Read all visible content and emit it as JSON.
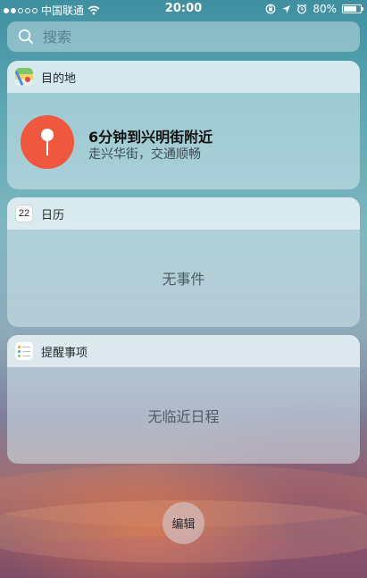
{
  "status_bar": {
    "carrier": "中国联通",
    "time": "20:00",
    "battery": "80%",
    "battery_level": 0.8,
    "signal_bars_filled": 2,
    "signal_bars_total": 5,
    "icons": [
      "wifi-icon",
      "orientation-lock-icon",
      "location-icon",
      "alarm-icon",
      "battery-icon"
    ]
  },
  "search": {
    "placeholder": "搜索",
    "icon": "search-icon"
  },
  "widgets": {
    "destinations": {
      "title": "目的地",
      "icon": "maps-app-icon",
      "headline": "6分钟到兴明街附近",
      "detail": "走兴华街，交通顺畅",
      "pin_icon": "map-pin-icon",
      "pin_color": "#f0573f"
    },
    "calendar": {
      "title": "日历",
      "icon_day": "22",
      "icon": "calendar-app-icon",
      "empty": "无事件"
    },
    "reminders": {
      "title": "提醒事项",
      "icon": "reminders-app-icon",
      "empty": "无临近日程"
    }
  },
  "edit": {
    "label": "编辑"
  }
}
